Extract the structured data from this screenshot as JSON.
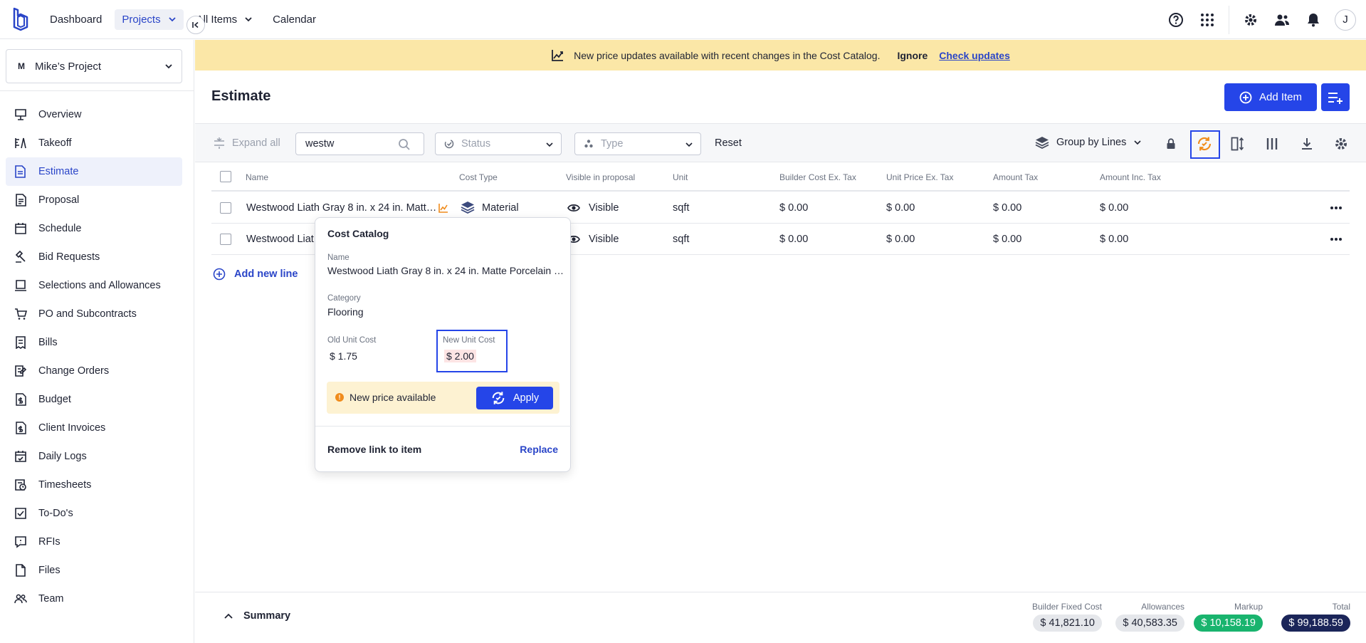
{
  "topnav": {
    "dashboard": "Dashboard",
    "projects": "Projects",
    "all_items": "All Items",
    "calendar": "Calendar",
    "avatar_initial": "J"
  },
  "sidebar": {
    "project_badge": "M",
    "project_name": "Mike’s Project",
    "items": [
      {
        "label": "Overview",
        "icon": "presentation-icon"
      },
      {
        "label": "Takeoff",
        "icon": "takeoff-icon"
      },
      {
        "label": "Estimate",
        "icon": "estimate-icon",
        "active": true
      },
      {
        "label": "Proposal",
        "icon": "proposal-icon"
      },
      {
        "label": "Schedule",
        "icon": "calendar-icon"
      },
      {
        "label": "Bid Requests",
        "icon": "bid-icon"
      },
      {
        "label": "Selections and Allowances",
        "icon": "selections-icon"
      },
      {
        "label": "PO and Subcontracts",
        "icon": "cart-icon"
      },
      {
        "label": "Bills",
        "icon": "bills-icon"
      },
      {
        "label": "Change Orders",
        "icon": "change-orders-icon"
      },
      {
        "label": "Budget",
        "icon": "budget-icon"
      },
      {
        "label": "Client Invoices",
        "icon": "invoice-icon"
      },
      {
        "label": "Daily Logs",
        "icon": "daily-log-icon"
      },
      {
        "label": "Timesheets",
        "icon": "timesheet-icon"
      },
      {
        "label": "To-Do's",
        "icon": "todo-icon"
      },
      {
        "label": "RFIs",
        "icon": "rfi-icon"
      },
      {
        "label": "Files",
        "icon": "file-icon"
      },
      {
        "label": "Team",
        "icon": "team-icon"
      }
    ]
  },
  "banner": {
    "message": "New price updates available with recent changes in the Cost Catalog.",
    "ignore": "Ignore",
    "check_updates": "Check updates"
  },
  "header": {
    "title": "Estimate",
    "add_item": "Add Item"
  },
  "toolbar": {
    "expand_all": "Expand all",
    "search_value": "westw",
    "status_placeholder": "Status",
    "type_placeholder": "Type",
    "reset": "Reset",
    "group_by": "Group by Lines"
  },
  "table": {
    "columns": [
      "Name",
      "Cost Type",
      "Visible in proposal",
      "Unit",
      "Builder Cost Ex. Tax",
      "Unit Price Ex. Tax",
      "Amount Tax",
      "Amount Inc. Tax"
    ],
    "rows": [
      {
        "name": "Westwood Liath Gray 8 in. x 24 in. Matt…",
        "cost_type": "Material",
        "visible": "Visible",
        "unit": "sqft",
        "builder_cost": "$ 0.00",
        "unit_price": "$ 0.00",
        "amount_tax": "$ 0.00",
        "amount_inc": "$ 0.00"
      },
      {
        "name": "Westwood Liat",
        "cost_type": "",
        "visible": "Visible",
        "unit": "sqft",
        "builder_cost": "$ 0.00",
        "unit_price": "$ 0.00",
        "amount_tax": "$ 0.00",
        "amount_inc": "$ 0.00"
      }
    ],
    "add_new_line": "Add new line"
  },
  "popover": {
    "title": "Cost Catalog",
    "name_label": "Name",
    "name_value": "Westwood Liath Gray 8 in. x 24 in. Matte Porcelain …",
    "category_label": "Category",
    "category_value": "Flooring",
    "old_cost_label": "Old Unit Cost",
    "old_cost_value": "$ 1.75",
    "new_cost_label": "New Unit Cost",
    "new_cost_value": "$ 2.00",
    "new_price_text": "New price available",
    "apply": "Apply",
    "remove_link": "Remove link to item",
    "replace": "Replace"
  },
  "summary": {
    "toggle": "Summary",
    "builder_fixed_cost_label": "Builder Fixed Cost",
    "builder_fixed_cost": "$ 41,821.10",
    "allowances_label": "Allowances",
    "allowances": "$ 40,583.35",
    "markup_label": "Markup",
    "markup": "$ 10,158.19",
    "total_label": "Total",
    "total": "$ 99,188.59"
  },
  "colors": {
    "accent": "#2545e8",
    "banner": "#fbe7a7",
    "markup": "#19b46e",
    "total": "#1b2559"
  }
}
